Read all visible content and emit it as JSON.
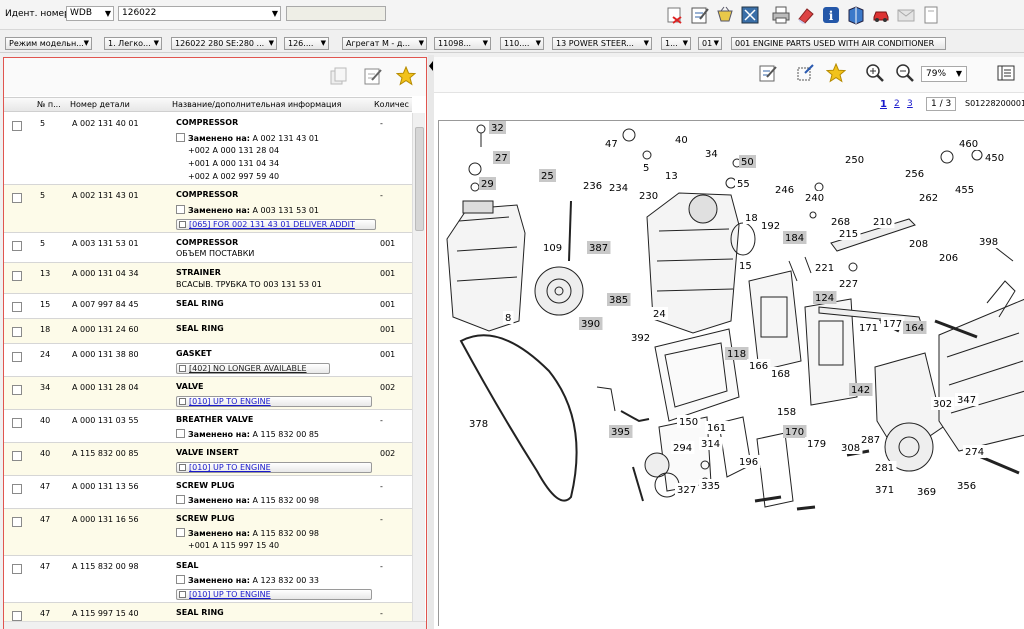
{
  "topbar": {
    "ident_label": "Идент. номер",
    "ident_type": "WDB",
    "ident_value": "126022",
    "icons": [
      "cart-remove-icon",
      "notes-icon",
      "basket-icon",
      "fullscreen-icon",
      "print-icon",
      "eraser-icon",
      "info-icon",
      "book-icon",
      "car-icon",
      "mail-icon"
    ]
  },
  "modelbar": {
    "chips": [
      "Режим модельн...",
      "1. Легко...",
      "126022 280 SE:280 ...",
      "126....",
      "Агрегат М - д...",
      "11098...",
      "110....",
      "13 POWER STEER...",
      "1...",
      "01",
      "001 ENGINE PARTS USED WITH AIR CONDITIONER"
    ]
  },
  "table": {
    "headers": {
      "pos": "№ п...",
      "part": "Номер детали",
      "name": "Название/дополнительная информация",
      "qty": "Количес"
    },
    "rows": [
      {
        "pos": "5",
        "part": "A 002 131 40 01",
        "name": "COMPRESSOR",
        "qty": "-",
        "sub1": "Заменено на:",
        "sub1v": " A 002 131 43 01",
        "l2": "+002 A 000 131 28 04",
        "l3": "+001 A 000 131 04 34",
        "l4": "+002 A 002 997 59 40"
      },
      {
        "pos": "5",
        "part": "A 002 131 43 01",
        "name": "COMPRESSOR",
        "qty": "-",
        "sub1": "Заменено на:",
        "sub1v": " A 003 131 53 01",
        "link": "[065] FOR 002 131 43 01 DELIVER ADDIT"
      },
      {
        "pos": "5",
        "part": "A 003 131 53 01",
        "name": "COMPRESSOR",
        "qty": "001",
        "plain": "ОБЪЕМ ПОСТАВКИ"
      },
      {
        "pos": "13",
        "part": "A 000 131 04 34",
        "name": "STRAINER",
        "qty": "001",
        "plain": "ВСАСЫВ. ТРУБКА ТО 003 131 53 01"
      },
      {
        "pos": "15",
        "part": "A 007 997 84 45",
        "name": "SEAL RING",
        "qty": "001"
      },
      {
        "pos": "18",
        "part": "A 000 131 24 60",
        "name": "SEAL RING",
        "qty": "001"
      },
      {
        "pos": "24",
        "part": "A 000 131 38 80",
        "name": "GASKET",
        "qty": "001",
        "link": "[402] NO LONGER AVAILABLE"
      },
      {
        "pos": "34",
        "part": "A 000 131 28 04",
        "name": "VALVE",
        "qty": "002",
        "link": "[010] UP TO ENGINE"
      },
      {
        "pos": "40",
        "part": "A 000 131 03 55",
        "name": "BREATHER VALVE",
        "qty": "-",
        "sub1": "Заменено на:",
        "sub1v": " A 115 832 00 85"
      },
      {
        "pos": "40",
        "part": "A 115 832 00 85",
        "name": "VALVE INSERT",
        "qty": "002",
        "link": "[010] UP TO ENGINE"
      },
      {
        "pos": "47",
        "part": "A 000 131 13 56",
        "name": "SCREW PLUG",
        "qty": "-",
        "sub1": "Заменено на:",
        "sub1v": " A 115 832 00 98"
      },
      {
        "pos": "47",
        "part": "A 000 131 16 56",
        "name": "SCREW PLUG",
        "qty": "-",
        "sub1": "Заменено на:",
        "sub1v": " A 115 832 00 98",
        "l2": "+001 A 115 997 15 40"
      },
      {
        "pos": "47",
        "part": "A 115 832 00 98",
        "name": "SEAL",
        "qty": "-",
        "sub1": "Заменено на:",
        "sub1v": " A 123 832 00 33",
        "link": "[010] UP TO ENGINE"
      },
      {
        "pos": "47",
        "part": "A 115 997 15 40",
        "name": "SEAL RING",
        "qty": "-"
      }
    ]
  },
  "viewer": {
    "zoom": "79%",
    "pages": [
      "1",
      "2",
      "3"
    ],
    "page_counter": "1 / 3",
    "sheet_id": "S01228200001",
    "labels": [
      {
        "t": "32",
        "hl": true
      },
      {
        "t": "27",
        "hl": true
      },
      {
        "t": "29",
        "hl": true
      },
      {
        "t": "25",
        "hl": true
      },
      {
        "t": "47",
        "hl": false
      },
      {
        "t": "40",
        "hl": false
      },
      {
        "t": "5",
        "hl": false
      },
      {
        "t": "13",
        "hl": false
      },
      {
        "t": "34",
        "hl": false
      },
      {
        "t": "50",
        "hl": true
      },
      {
        "t": "55",
        "hl": false
      },
      {
        "t": "236",
        "hl": false
      },
      {
        "t": "234",
        "hl": false
      },
      {
        "t": "230",
        "hl": false
      },
      {
        "t": "250",
        "hl": false
      },
      {
        "t": "460",
        "hl": false
      },
      {
        "t": "450",
        "hl": false
      },
      {
        "t": "256",
        "hl": false
      },
      {
        "t": "455",
        "hl": false
      },
      {
        "t": "246",
        "hl": false
      },
      {
        "t": "240",
        "hl": false
      },
      {
        "t": "262",
        "hl": false
      },
      {
        "t": "268",
        "hl": false
      },
      {
        "t": "215",
        "hl": false
      },
      {
        "t": "210",
        "hl": false
      },
      {
        "t": "208",
        "hl": false
      },
      {
        "t": "206",
        "hl": false
      },
      {
        "t": "398",
        "hl": false
      },
      {
        "t": "221",
        "hl": false
      },
      {
        "t": "227",
        "hl": false
      },
      {
        "t": "18",
        "hl": false
      },
      {
        "t": "192",
        "hl": false
      },
      {
        "t": "184",
        "hl": true
      },
      {
        "t": "109",
        "hl": false
      },
      {
        "t": "387",
        "hl": true
      },
      {
        "t": "15",
        "hl": false
      },
      {
        "t": "8",
        "hl": false
      },
      {
        "t": "385",
        "hl": true
      },
      {
        "t": "390",
        "hl": true
      },
      {
        "t": "392",
        "hl": false
      },
      {
        "t": "24",
        "hl": false
      },
      {
        "t": "124",
        "hl": true
      },
      {
        "t": "171",
        "hl": false
      },
      {
        "t": "177",
        "hl": false
      },
      {
        "t": "164",
        "hl": true
      },
      {
        "t": "118",
        "hl": true
      },
      {
        "t": "166",
        "hl": false
      },
      {
        "t": "168",
        "hl": false
      },
      {
        "t": "142",
        "hl": true
      },
      {
        "t": "302",
        "hl": false
      },
      {
        "t": "347",
        "hl": false
      },
      {
        "t": "378",
        "hl": false
      },
      {
        "t": "150",
        "hl": false
      },
      {
        "t": "161",
        "hl": false
      },
      {
        "t": "158",
        "hl": false
      },
      {
        "t": "395",
        "hl": true
      },
      {
        "t": "170",
        "hl": true
      },
      {
        "t": "179",
        "hl": false
      },
      {
        "t": "294",
        "hl": false
      },
      {
        "t": "314",
        "hl": false
      },
      {
        "t": "196",
        "hl": false
      },
      {
        "t": "308",
        "hl": false
      },
      {
        "t": "287",
        "hl": false
      },
      {
        "t": "274",
        "hl": false
      },
      {
        "t": "281",
        "hl": false
      },
      {
        "t": "327",
        "hl": false
      },
      {
        "t": "335",
        "hl": false
      },
      {
        "t": "371",
        "hl": false
      },
      {
        "t": "369",
        "hl": false
      },
      {
        "t": "356",
        "hl": false
      }
    ]
  },
  "colors": {
    "accent_border": "#e0554f",
    "row_alt": "#fdfbe9",
    "link": "#1a1acc",
    "label_hl": "#c8c8c8"
  }
}
